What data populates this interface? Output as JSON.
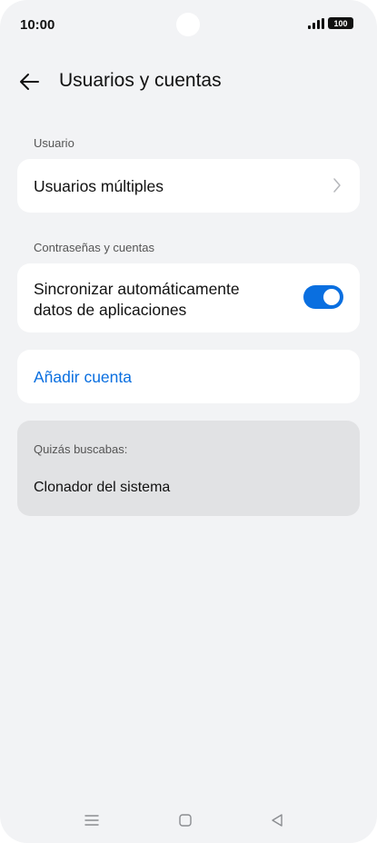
{
  "status_bar": {
    "time": "10:00",
    "battery": "100"
  },
  "header": {
    "title": "Usuarios y cuentas",
    "back_icon": "arrow-left-icon"
  },
  "sections": {
    "usuario": {
      "label": "Usuario",
      "item_label": "Usuarios múltiples"
    },
    "cuentas": {
      "label": "Contraseñas y cuentas",
      "sync_line1": "Sincronizar automáticamente",
      "sync_line2": "datos de aplicaciones",
      "sync_enabled": true,
      "add_account": "Añadir cuenta"
    }
  },
  "suggestion": {
    "label": "Quizás buscabas:",
    "item": "Clonador del sistema"
  },
  "colors": {
    "accent": "#0a6fe0",
    "background": "#f2f3f5",
    "card": "#ffffff",
    "suggestion_bg": "#e1e2e4"
  },
  "nav_bar": {
    "icons": [
      "menu-icon",
      "home-icon",
      "back-triangle-icon"
    ]
  }
}
